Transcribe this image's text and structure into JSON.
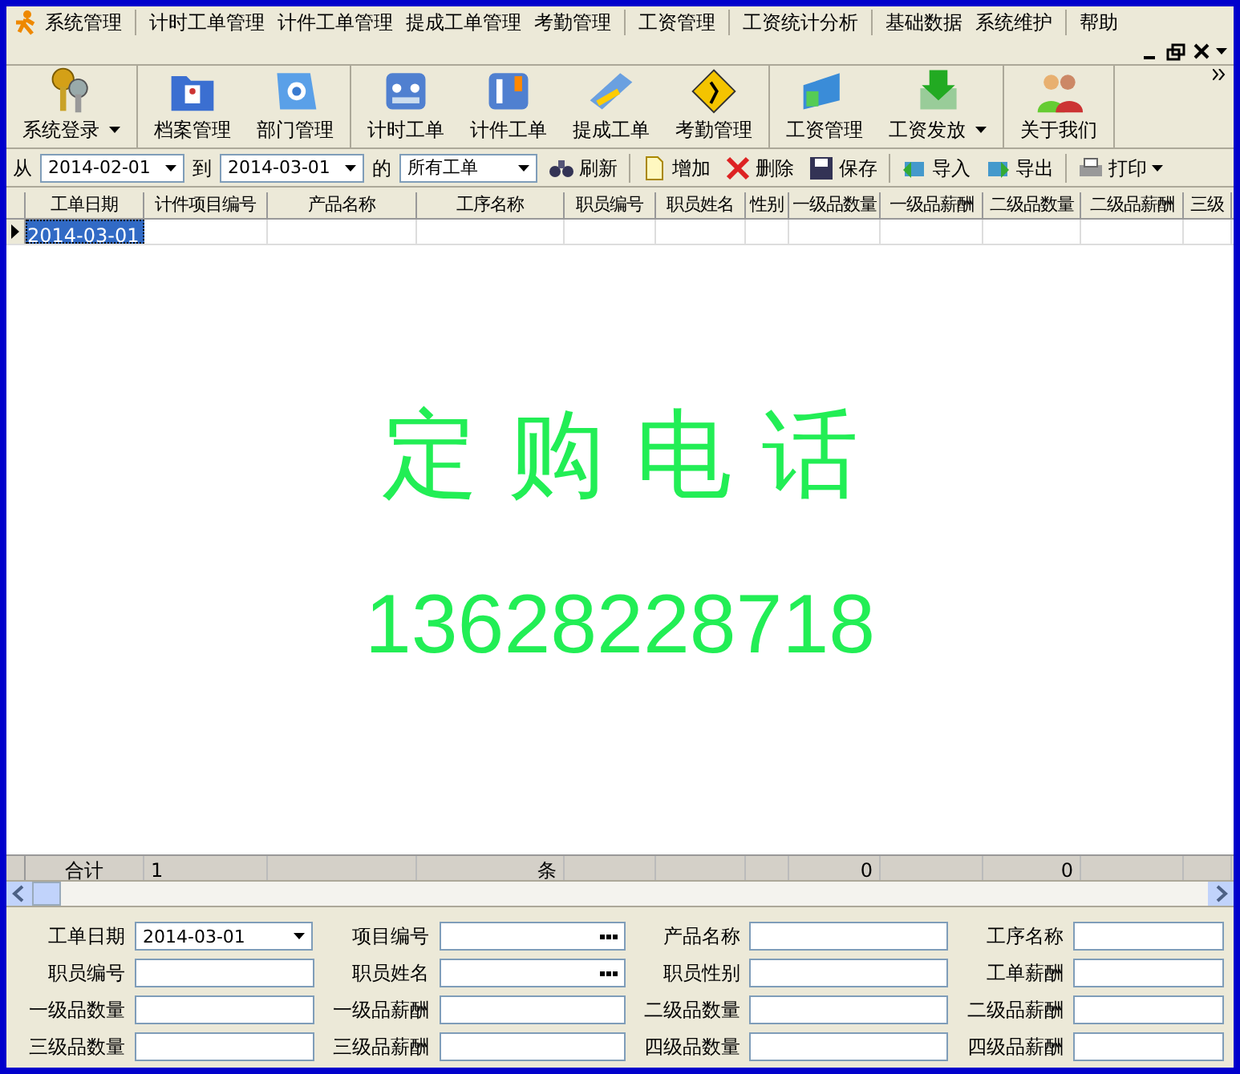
{
  "menu": [
    "系统管理",
    "计时工单管理",
    "计件工单管理",
    "提成工单管理",
    "考勤管理",
    "工资管理",
    "工资统计分析",
    "基础数据",
    "系统维护",
    "帮助"
  ],
  "toolbar": {
    "groups": [
      {
        "items": [
          {
            "label": "系统登录",
            "dropdown": true
          }
        ]
      },
      {
        "items": [
          {
            "label": "档案管理",
            "dropdown": false
          },
          {
            "label": "部门管理",
            "dropdown": false
          }
        ]
      },
      {
        "items": [
          {
            "label": "计时工单",
            "dropdown": false
          },
          {
            "label": "计件工单",
            "dropdown": false
          },
          {
            "label": "提成工单",
            "dropdown": false
          },
          {
            "label": "考勤管理",
            "dropdown": false
          }
        ]
      },
      {
        "items": [
          {
            "label": "工资管理",
            "dropdown": false
          },
          {
            "label": "工资发放",
            "dropdown": true
          }
        ]
      },
      {
        "items": [
          {
            "label": "关于我们",
            "dropdown": false
          }
        ]
      }
    ]
  },
  "filter": {
    "from_label": "从",
    "from_value": "2014-02-01",
    "to_label": "到",
    "to_value": "2014-03-01",
    "of_label": "的",
    "type_value": "所有工单",
    "buttons": [
      {
        "label": "刷新",
        "dropdown": false
      },
      {
        "label": "增加",
        "dropdown": false
      },
      {
        "label": "删除",
        "dropdown": false
      },
      {
        "label": "保存",
        "dropdown": false
      },
      {
        "label": "导入",
        "dropdown": false
      },
      {
        "label": "导出",
        "dropdown": false
      },
      {
        "label": "打印",
        "dropdown": true
      }
    ]
  },
  "table": {
    "columns": [
      "工单日期",
      "计件项目编号",
      "产品名称",
      "工序名称",
      "职员编号",
      "职员姓名",
      "性别",
      "一级品数量",
      "一级品薪酬",
      "二级品数量",
      "二级品薪酬",
      "三级"
    ],
    "rows": [
      {
        "selected": true,
        "cells": [
          "2014-03-01",
          "",
          "",
          "",
          "",
          "",
          "",
          "",
          "",
          "",
          "",
          ""
        ]
      }
    ],
    "total": {
      "label": "合计",
      "count": "1",
      "unit": "条",
      "grade1_quantity": "0",
      "grade2_quantity": "0"
    }
  },
  "banner": {
    "title": "定 购 电 话",
    "phone": "13628228718"
  },
  "form": [
    [
      {
        "label": "工单日期",
        "value": "2014-03-01",
        "kind": "date"
      },
      {
        "label": "项目编号",
        "kind": "lookup"
      },
      {
        "label": "产品名称",
        "kind": "text"
      },
      {
        "label": "工序名称",
        "kind": "text"
      }
    ],
    [
      {
        "label": "职员编号",
        "kind": "text"
      },
      {
        "label": "职员姓名",
        "kind": "lookup"
      },
      {
        "label": "职员性别",
        "kind": "text"
      },
      {
        "label": "工单薪酬",
        "kind": "text"
      }
    ],
    [
      {
        "label": "一级品数量",
        "kind": "text"
      },
      {
        "label": "一级品薪酬",
        "kind": "text"
      },
      {
        "label": "二级品数量",
        "kind": "text"
      },
      {
        "label": "二级品薪酬",
        "kind": "text"
      }
    ],
    [
      {
        "label": "三级品数量",
        "kind": "text"
      },
      {
        "label": "三级品薪酬",
        "kind": "text"
      },
      {
        "label": "四级品数量",
        "kind": "text"
      },
      {
        "label": "四级品薪酬",
        "kind": "text"
      }
    ]
  ]
}
